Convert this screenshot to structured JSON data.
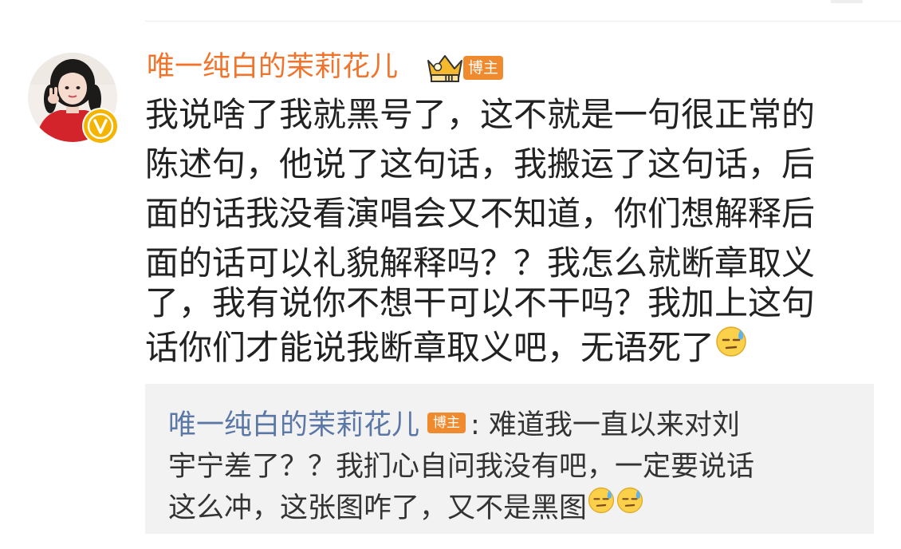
{
  "post": {
    "username": "唯一纯白的茉莉花儿",
    "badge": "博主",
    "crown_level": "III",
    "lines": [
      "我说啥了我就黑号了，这不就是一句很正常的",
      "陈述句，他说了这句话，我搬运了这句话，后",
      "面的话我没看演唱会又不知道，你们想解释后",
      "面的话可以礼貌解释吗？？我怎么就断章取义",
      "了，我有说你不想干可以不干吗？我加上这句",
      "话你们才能说我断章取义吧，无语死了"
    ],
    "emoji": "sweat-emoji"
  },
  "quote": {
    "username": "唯一纯白的茉莉花儿",
    "badge": "博主",
    "lines": [
      ": 难道我一直以来对刘",
      "宇宁差了？？我扪心自问我没有吧，一定要说话",
      "这么冲，这张图咋了，又不是黑图"
    ],
    "emoji_count": 2
  },
  "colors": {
    "username_orange": "#f0742b",
    "badge_orange": "#f08a2e",
    "quote_user_blue": "#5b77a6",
    "quote_background": "#f2f2f2",
    "text": "#222222"
  }
}
